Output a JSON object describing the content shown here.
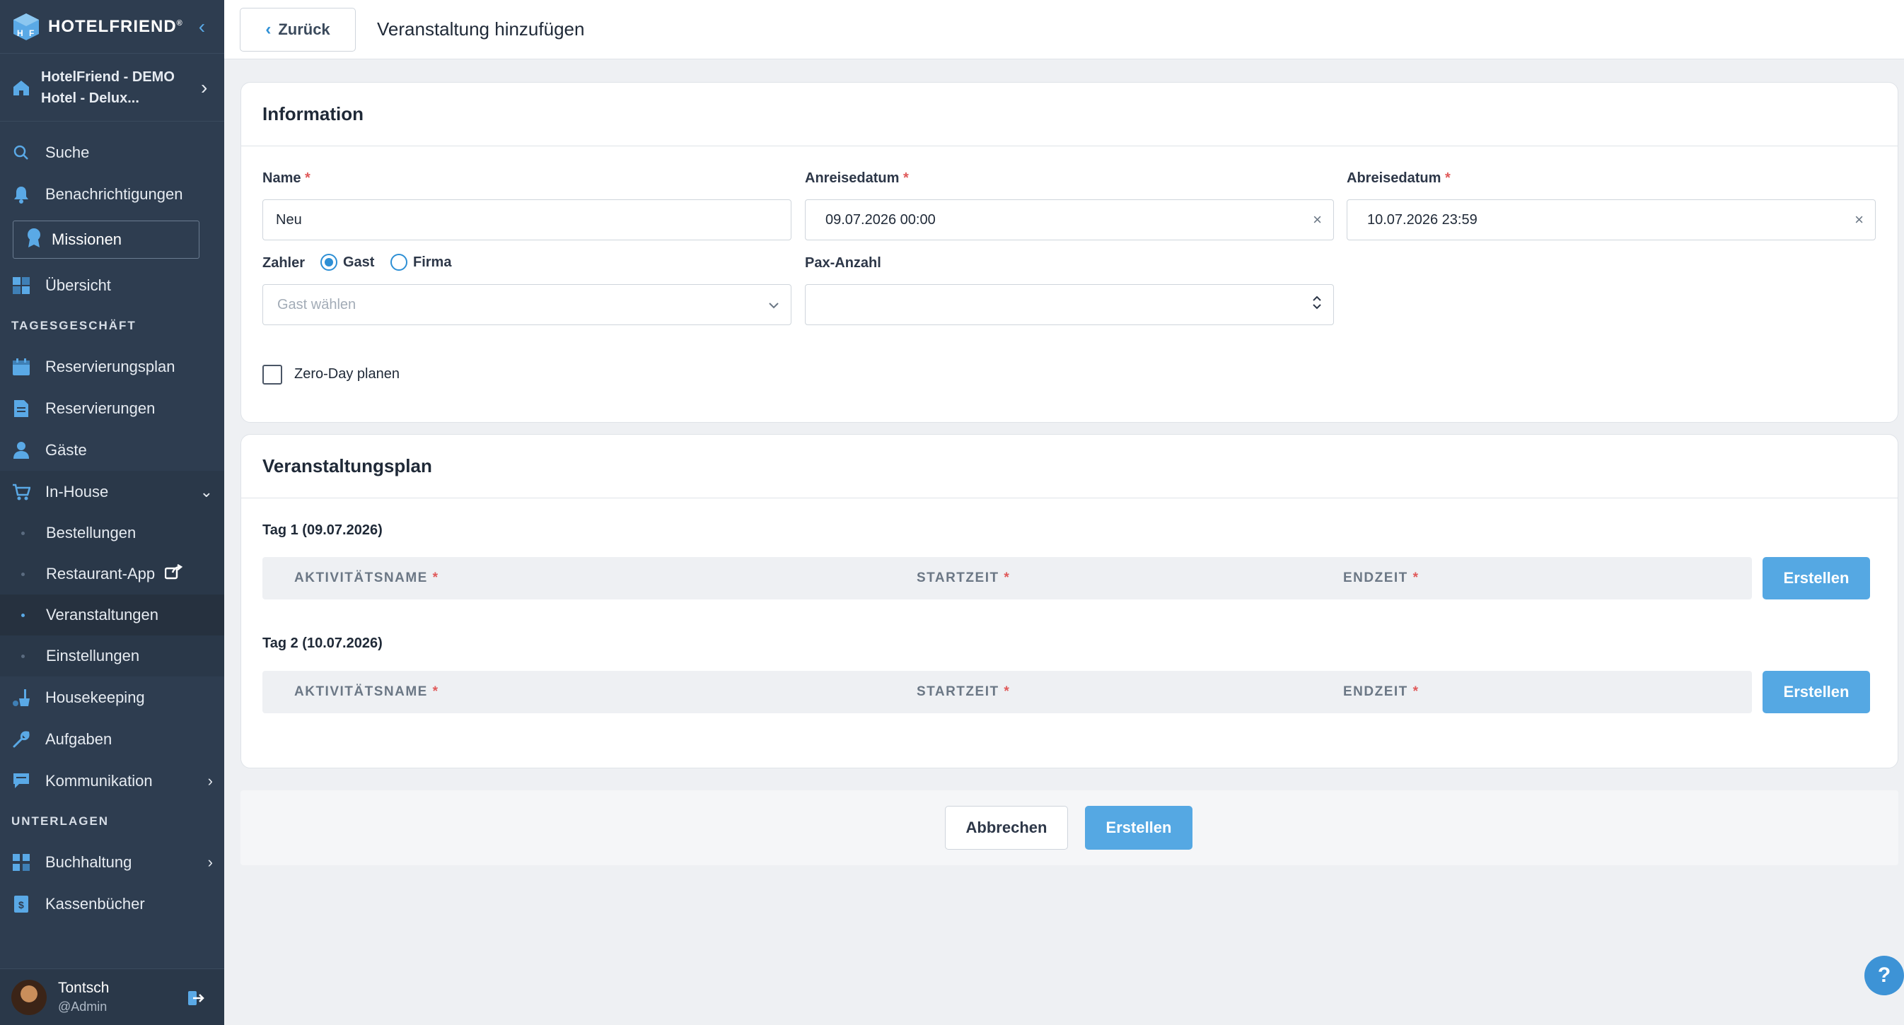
{
  "sidebar": {
    "logo_text": "HOTELFRIEND",
    "logo_reg": "®",
    "hotel_name": "HotelFriend - DEMO Hotel - Delux...",
    "search": "Suche",
    "notifications": "Benachrichtigungen",
    "missions": "Missionen",
    "overview": "Übersicht",
    "section_daily": "TAGESGESCHÄFT",
    "reservation_plan": "Reservierungsplan",
    "reservations": "Reservierungen",
    "guests": "Gäste",
    "inhouse": "In-House",
    "inhouse_sub": [
      "Bestellungen",
      "Restaurant-App",
      "Veranstaltungen",
      "Einstellungen"
    ],
    "housekeeping": "Housekeeping",
    "tasks": "Aufgaben",
    "communication": "Kommunikation",
    "section_docs": "UNTERLAGEN",
    "accounting": "Buchhaltung",
    "cashbooks": "Kassenbücher",
    "user_name": "Tontsch",
    "user_role": "@Admin"
  },
  "topbar": {
    "back_label": "Zurück",
    "title": "Veranstaltung hinzufügen"
  },
  "info": {
    "title": "Information",
    "name_label": "Name",
    "name_value": "Neu",
    "arrival_label": "Anreisedatum",
    "arrival_value": "09.07.2026 00:00",
    "departure_label": "Abreisedatum",
    "departure_value": "10.07.2026 23:59",
    "payer_label": "Zahler",
    "payer_options": [
      "Gast",
      "Firma"
    ],
    "payer_selected": "Gast",
    "guest_placeholder": "Gast wählen",
    "pax_label": "Pax-Anzahl",
    "pax_value": "",
    "zero_day_label": "Zero-Day planen",
    "required_mark": "*",
    "clear_glyph": "×"
  },
  "plan": {
    "title": "Veranstaltungsplan",
    "days": [
      {
        "label": "Tag 1 (09.07.2026)"
      },
      {
        "label": "Tag 2 (10.07.2026)"
      }
    ],
    "col_activity": "AKTIVITÄTSNAME",
    "col_start": "STARTZEIT",
    "col_end": "ENDZEIT",
    "create_label": "Erstellen"
  },
  "actions": {
    "cancel": "Abbrechen",
    "create": "Erstellen"
  },
  "help": "?",
  "colors": {
    "sidebar_bg": "#2e3d50",
    "accent": "#55a8e3",
    "required": "#e05a5a"
  }
}
